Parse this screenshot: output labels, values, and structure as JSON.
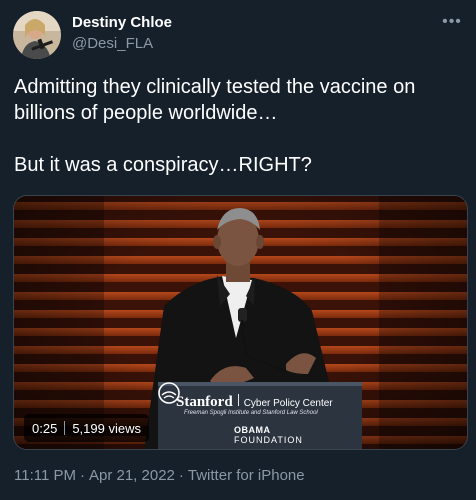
{
  "author": {
    "name": "Destiny Chloe",
    "handle": "@Desi_FLA",
    "avatar_icon": "profile-photo"
  },
  "more_icon": "ellipsis-icon",
  "tweet": {
    "line1": "Admitting they clinically tested the vaccine on billions of people worldwide…",
    "line2": "But it was a conspiracy…RIGHT?"
  },
  "media": {
    "podium": {
      "stanford": "Stanford",
      "center": "Cyber Policy Center",
      "subtitle": "Freeman Spogli Institute and Stanford Law School",
      "obama_top": "OBAMA",
      "obama_bottom": "FOUNDATION"
    },
    "duration": "0:25",
    "views": "5,199 views"
  },
  "meta": {
    "time": "11:11 PM",
    "date": "Apr 21, 2022",
    "dot": "·",
    "source": "Twitter for iPhone"
  },
  "colors": {
    "background": "#15202b",
    "secondary_text": "#8b98a5",
    "primary_text": "#ffffff",
    "border": "#38444d"
  }
}
